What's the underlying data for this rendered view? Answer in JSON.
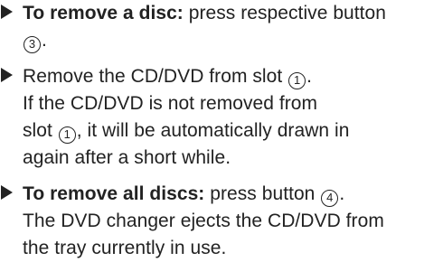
{
  "steps": [
    {
      "bold": "To remove a disc:",
      "line1_text": " press respective button",
      "line2_num": "3",
      "line2_after": "."
    },
    {
      "line1_before": "Remove the CD/DVD from slot ",
      "line1_num": "1",
      "line1_after": ".",
      "line2": "If the CD/DVD is not removed from",
      "line3_before": "slot ",
      "line3_num": "1",
      "line3_after": ", it will be automatically drawn in",
      "line4": "again after a short while."
    },
    {
      "bold": "To remove all discs:",
      "line1_before": " press button ",
      "line1_num": "4",
      "line1_after": ".",
      "line2": "The DVD changer ejects the CD/DVD from",
      "line3": "the tray currently in use."
    }
  ]
}
